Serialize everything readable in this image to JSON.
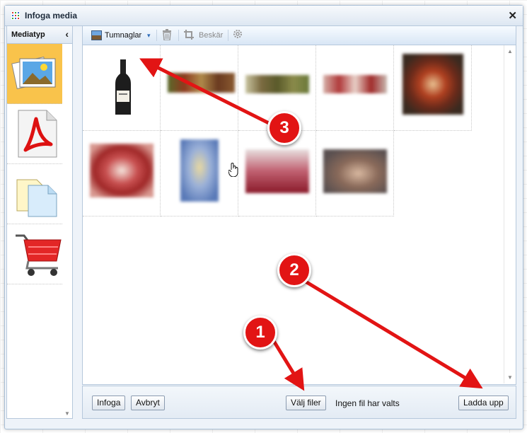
{
  "window": {
    "title": "Infoga media",
    "close": "✕"
  },
  "left_panel": {
    "title": "Mediatyp",
    "collapse": "‹",
    "items": [
      {
        "name": "images",
        "icon": "photo-stack-icon",
        "active": true
      },
      {
        "name": "pdf",
        "icon": "pdf-icon",
        "active": false
      },
      {
        "name": "documents",
        "icon": "documents-icon",
        "active": false
      },
      {
        "name": "products",
        "icon": "shopping-cart-icon",
        "active": false
      }
    ]
  },
  "toolbar": {
    "view_label": "Tumnaglar",
    "view_caret": "▾",
    "delete_icon": "trash-icon",
    "crop_label": "Beskär",
    "settings_icon": "gear-icon"
  },
  "thumbnails": [
    {
      "name": "wine-bottle"
    },
    {
      "name": "food-banner-1"
    },
    {
      "name": "food-banner-2"
    },
    {
      "name": "food-banner-3"
    },
    {
      "name": "grill-skewers"
    },
    {
      "name": "red-swirl"
    },
    {
      "name": "champagne-glass"
    },
    {
      "name": "wine-glasses"
    },
    {
      "name": "person-portrait"
    }
  ],
  "bottom": {
    "insert_label": "Infoga",
    "cancel_label": "Avbryt",
    "choose_files_label": "Välj filer",
    "no_file_text": "Ingen fil har valts",
    "upload_label": "Ladda upp"
  },
  "annotations": {
    "one": "1",
    "two": "2",
    "three": "3"
  },
  "colors": {
    "accent_active": "#f9c34b",
    "annotation_red": "#e21414",
    "frame_blue": "#b6c8dc"
  }
}
